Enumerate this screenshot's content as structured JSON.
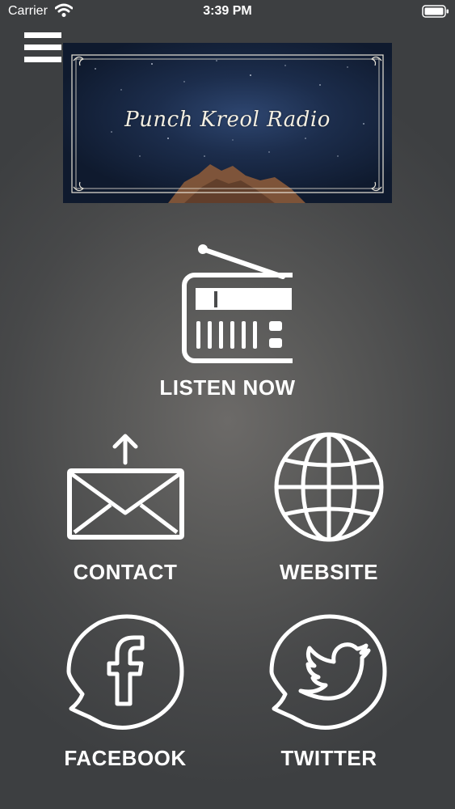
{
  "status_bar": {
    "carrier": "Carrier",
    "time": "3:39 PM"
  },
  "banner": {
    "title": "Punch Kreol Radio"
  },
  "actions": {
    "listen": {
      "label": "LISTEN NOW",
      "icon": "radio-icon"
    },
    "contact": {
      "label": "CONTACT",
      "icon": "envelope-upload-icon"
    },
    "website": {
      "label": "WEBSITE",
      "icon": "globe-icon"
    },
    "facebook": {
      "label": "FACEBOOK",
      "icon": "facebook-icon"
    },
    "twitter": {
      "label": "TWITTER",
      "icon": "twitter-icon"
    }
  },
  "colors": {
    "background": "#4a4b4c",
    "foreground": "#ffffff",
    "banner_sky": "#1c2d4c"
  }
}
